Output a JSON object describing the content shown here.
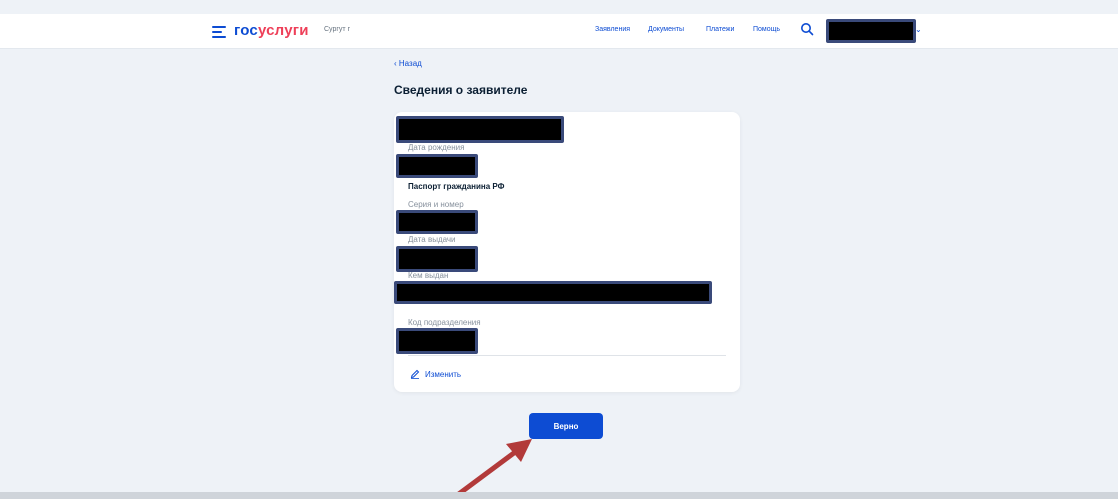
{
  "header": {
    "logo_part1": "гос",
    "logo_part2": "услуги",
    "city": "Сургут г",
    "nav": [
      "Заявления",
      "Документы",
      "Платежи",
      "Помощь"
    ]
  },
  "back_label": "Назад",
  "title": "Сведения о заявителе",
  "fields": {
    "birth_date_label": "Дата рождения",
    "passport_title": "Паспорт гражданина РФ",
    "series_label": "Серия и номер",
    "issue_date_label": "Дата выдачи",
    "issued_by_label": "Кем выдан",
    "division_code_label": "Код подразделения"
  },
  "edit_label": "Изменить",
  "confirm_label": "Верно",
  "colors": {
    "accent": "#0d4cd3",
    "logo_red": "#ee3f58",
    "arrow": "#b23a3a"
  }
}
